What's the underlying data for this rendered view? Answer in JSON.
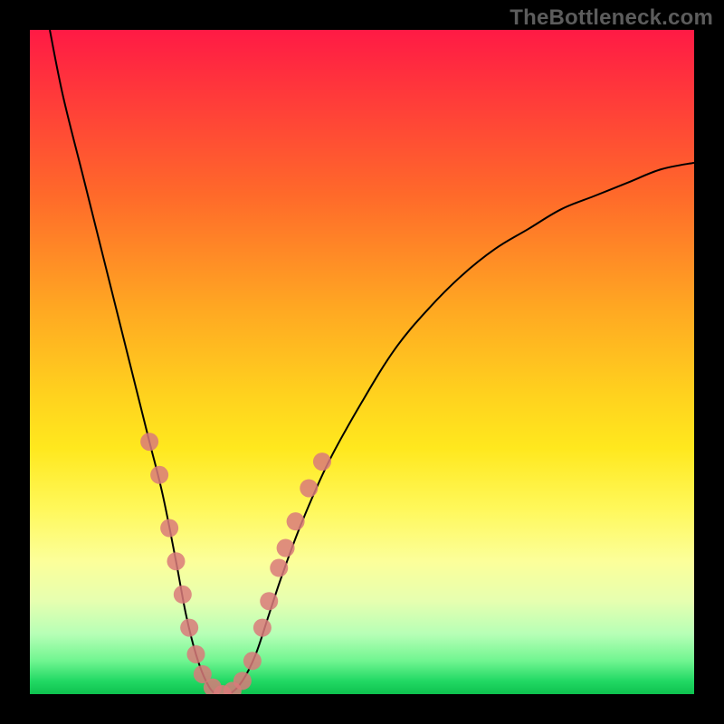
{
  "watermark": {
    "text": "TheBottleneck.com"
  },
  "chart_data": {
    "type": "line",
    "title": "",
    "xlabel": "",
    "ylabel": "",
    "xlim": [
      0,
      100
    ],
    "ylim": [
      0,
      100
    ],
    "grid": false,
    "legend": false,
    "series": [
      {
        "name": "bottleneck-curve",
        "x": [
          3,
          5,
          8,
          10,
          12,
          14,
          16,
          18,
          20,
          22,
          23.5,
          25,
          26.5,
          28,
          30,
          32,
          34,
          36,
          38,
          41,
          45,
          50,
          55,
          60,
          65,
          70,
          75,
          80,
          85,
          90,
          95,
          100
        ],
        "values": [
          100,
          90,
          78,
          70,
          62,
          54,
          46,
          38,
          30,
          20,
          12,
          6,
          2,
          0,
          0,
          2,
          6,
          12,
          18,
          26,
          35,
          44,
          52,
          58,
          63,
          67,
          70,
          73,
          75,
          77,
          79,
          80
        ]
      }
    ],
    "markers": [
      {
        "name": "data-points",
        "color": "#d97a7a",
        "points": [
          {
            "x": 18,
            "y": 38
          },
          {
            "x": 19.5,
            "y": 33
          },
          {
            "x": 21,
            "y": 25
          },
          {
            "x": 22,
            "y": 20
          },
          {
            "x": 23,
            "y": 15
          },
          {
            "x": 24,
            "y": 10
          },
          {
            "x": 25,
            "y": 6
          },
          {
            "x": 26,
            "y": 3
          },
          {
            "x": 27.5,
            "y": 1
          },
          {
            "x": 29,
            "y": 0
          },
          {
            "x": 30.5,
            "y": 0.5
          },
          {
            "x": 32,
            "y": 2
          },
          {
            "x": 33.5,
            "y": 5
          },
          {
            "x": 35,
            "y": 10
          },
          {
            "x": 36,
            "y": 14
          },
          {
            "x": 37.5,
            "y": 19
          },
          {
            "x": 38.5,
            "y": 22
          },
          {
            "x": 40,
            "y": 26
          },
          {
            "x": 42,
            "y": 31
          },
          {
            "x": 44,
            "y": 35
          }
        ]
      }
    ]
  }
}
